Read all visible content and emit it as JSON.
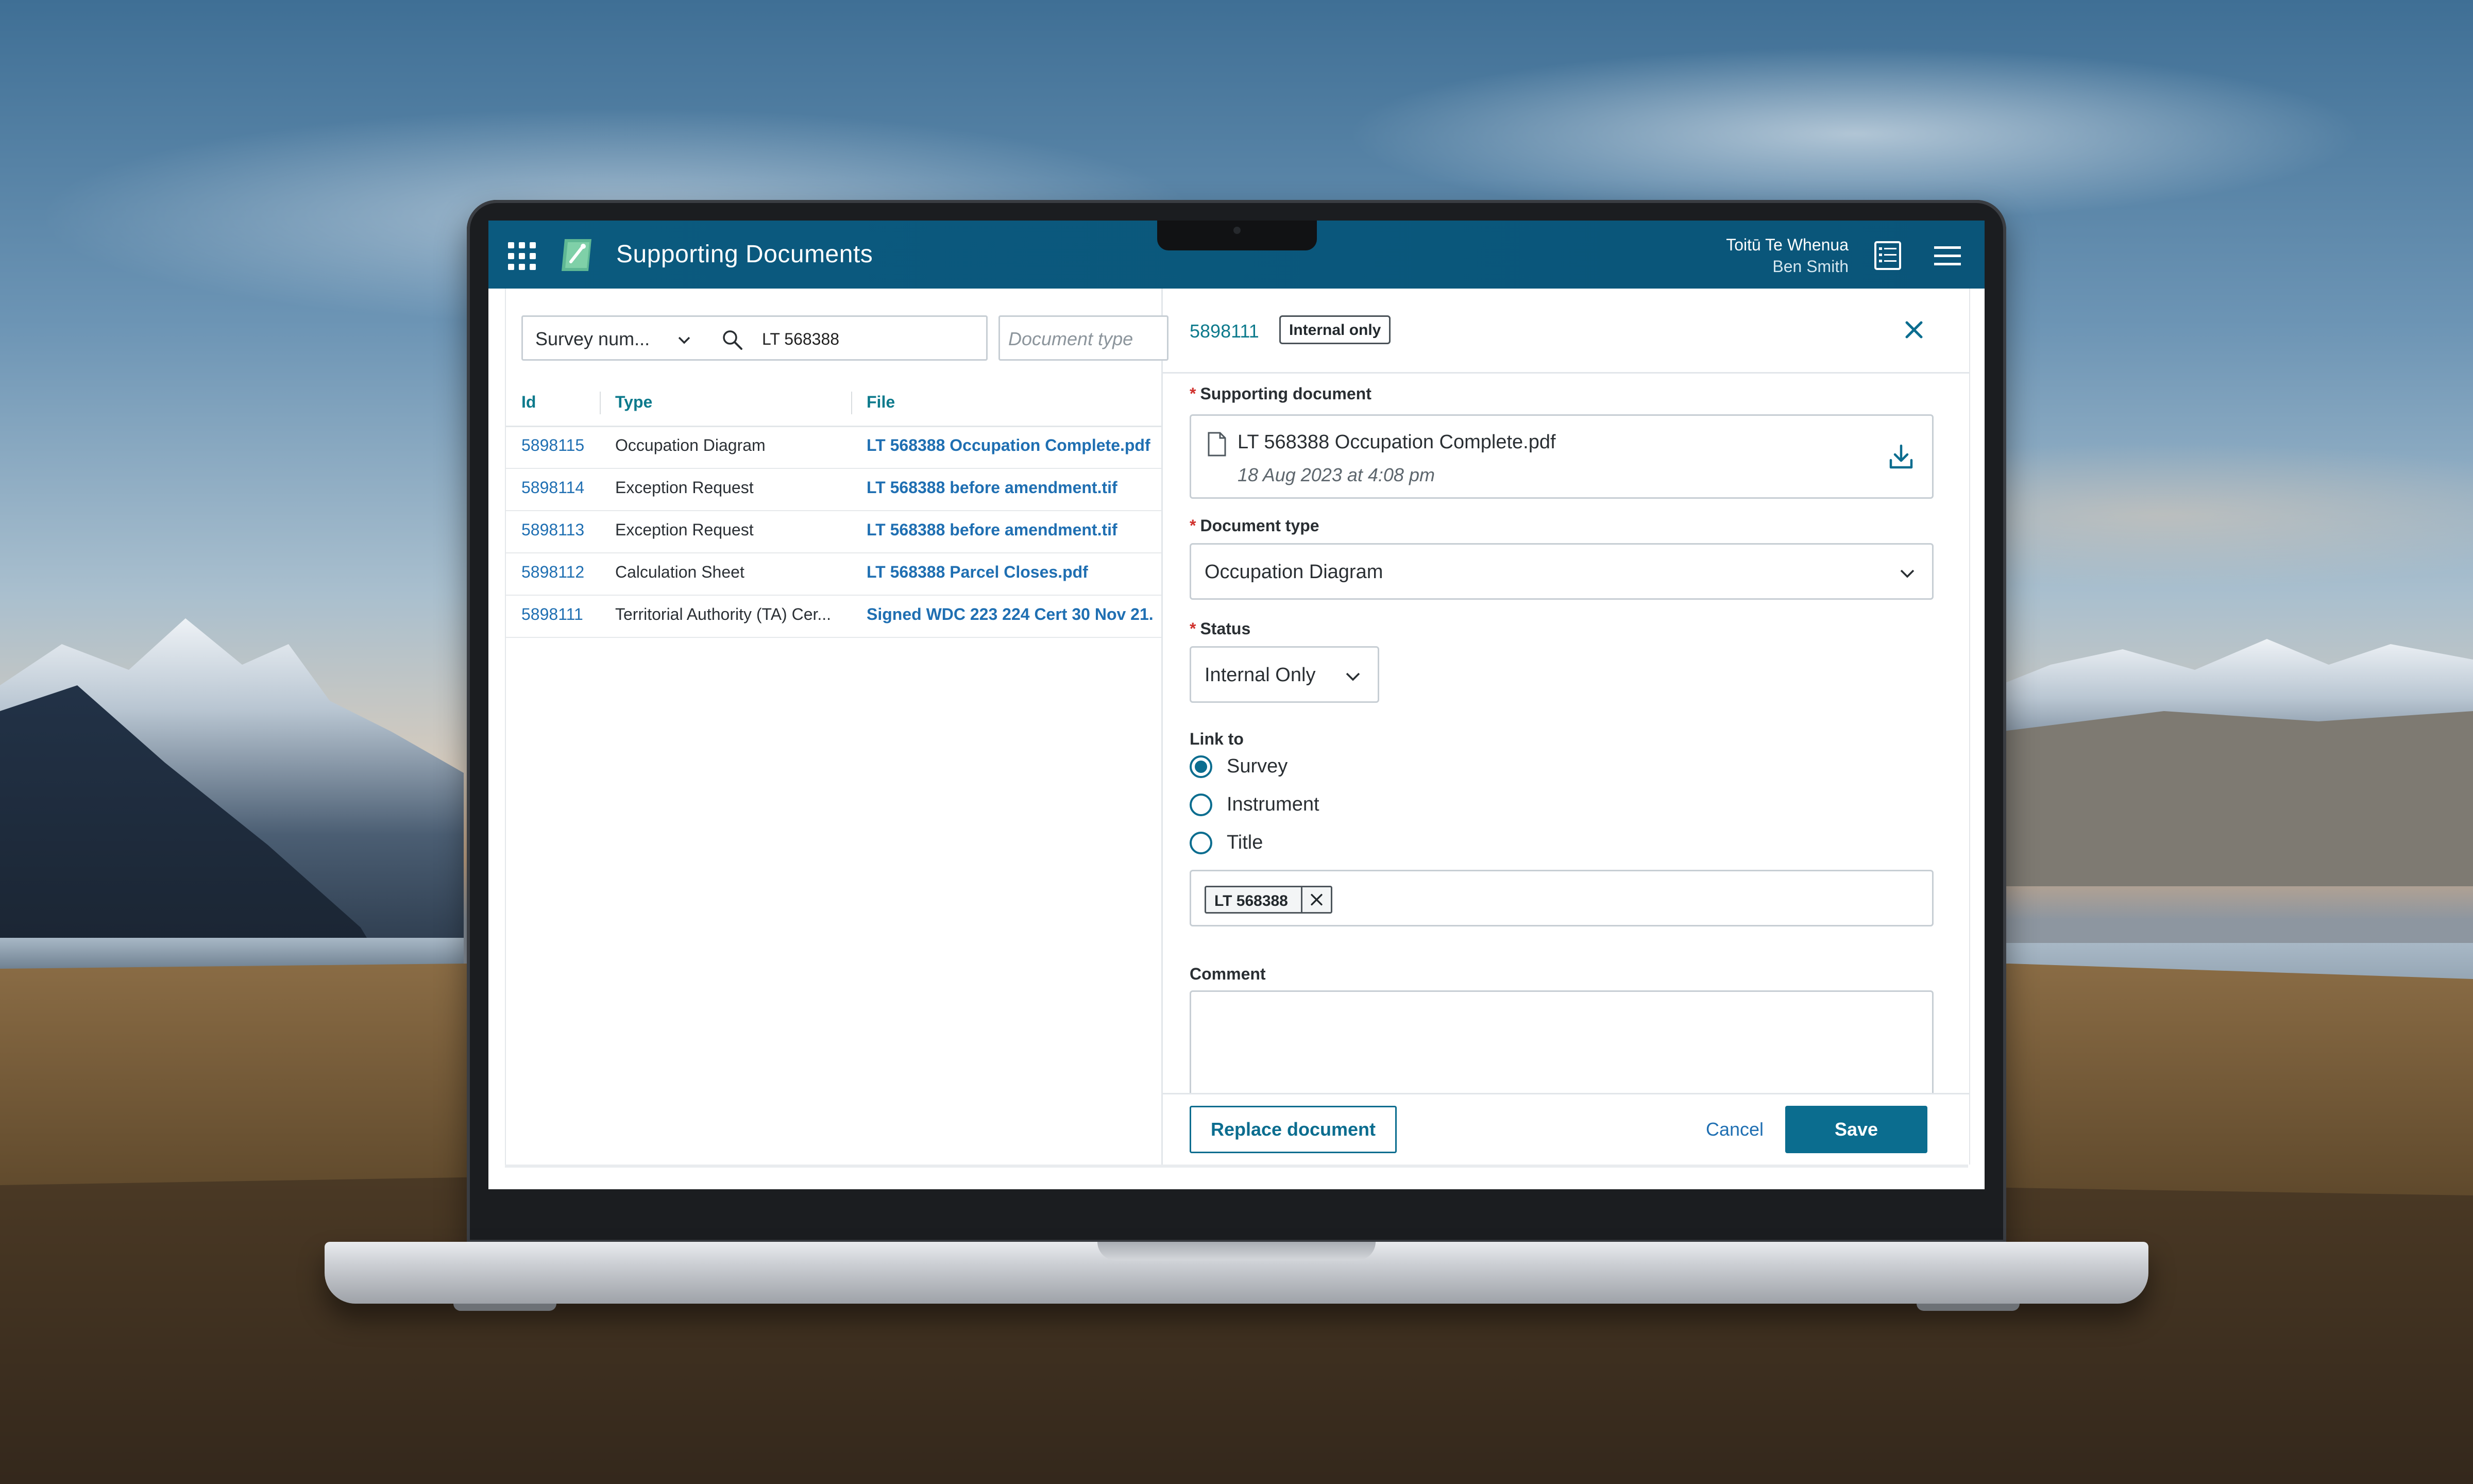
{
  "app": {
    "title": "Supporting Documents",
    "organisation": "Toitū Te Whenua",
    "user": "Ben Smith"
  },
  "filters": {
    "search_by": "Survey num...",
    "search_value": "LT 568388",
    "document_type_placeholder": "Document type"
  },
  "grid": {
    "columns": [
      "Id",
      "Type",
      "File"
    ],
    "rows": [
      {
        "id": "5898115",
        "type": "Occupation Diagram",
        "file": "LT 568388 Occupation Complete.pdf"
      },
      {
        "id": "5898114",
        "type": "Exception Request",
        "file": "LT 568388 before amendment.tif"
      },
      {
        "id": "5898113",
        "type": "Exception Request",
        "file": "LT 568388 before amendment.tif"
      },
      {
        "id": "5898112",
        "type": "Calculation Sheet",
        "file": "LT 568388 Parcel Closes.pdf"
      },
      {
        "id": "5898111",
        "type": "Territorial Authority (TA) Cer...",
        "file": "Signed WDC 223 224 Cert 30 Nov 21."
      }
    ]
  },
  "detail": {
    "id": "5898111",
    "badge": "Internal only",
    "supporting_document_label": "Supporting document",
    "file_name": "LT 568388 Occupation Complete.pdf",
    "file_date": "18 Aug 2023 at 4:08 pm",
    "document_type_label": "Document type",
    "document_type_value": "Occupation Diagram",
    "status_label": "Status",
    "status_value": "Internal Only",
    "link_to_label": "Link to",
    "link_options": [
      {
        "label": "Survey",
        "selected": true
      },
      {
        "label": "Instrument",
        "selected": false
      },
      {
        "label": "Title",
        "selected": false
      }
    ],
    "linked_tag": "LT 568388",
    "comment_label": "Comment",
    "comment_value": "",
    "required_marker": "*"
  },
  "actions": {
    "replace": "Replace document",
    "cancel": "Cancel",
    "save": "Save"
  },
  "colors": {
    "header": "#0b5a7f",
    "accent": "#0b6d8f",
    "link": "#1f6fb2",
    "teal_text": "#0d7a8c",
    "required": "#d0312d"
  },
  "icons": [
    "apps-grid-icon",
    "app-logo-icon",
    "report-list-icon",
    "hamburger-menu-icon",
    "chevron-down-icon",
    "search-icon",
    "close-icon",
    "file-icon",
    "download-icon",
    "remove-tag-icon"
  ]
}
